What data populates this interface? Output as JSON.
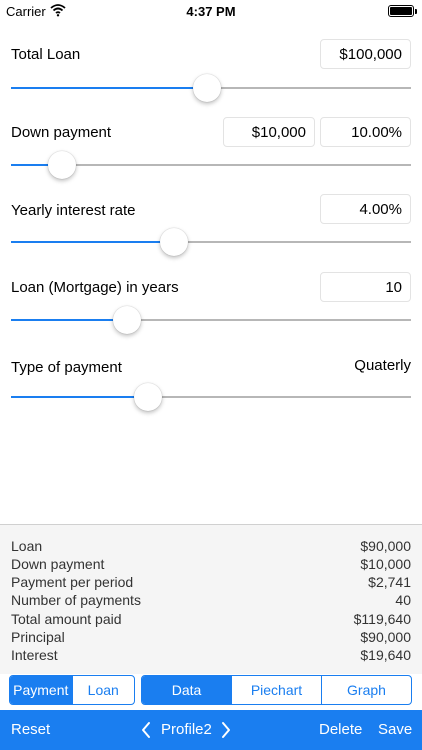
{
  "status_bar": {
    "carrier": "Carrier",
    "time": "4:37 PM"
  },
  "inputs": {
    "total_loan": {
      "label": "Total Loan",
      "value": "$100,000",
      "slider_fraction": 0.49
    },
    "down_payment": {
      "label": "Down payment",
      "amount": "$10,000",
      "percent": "10.00%",
      "slider_fraction": 0.127
    },
    "interest_rate": {
      "label": "Yearly interest rate",
      "value": "4.00%",
      "slider_fraction": 0.407
    },
    "years": {
      "label": "Loan (Mortgage) in years",
      "value": "10",
      "slider_fraction": 0.29
    },
    "payment_type": {
      "label": "Type of payment",
      "value": "Quaterly",
      "slider_fraction": 0.343
    }
  },
  "summary": [
    {
      "label": "Loan",
      "value": "$90,000"
    },
    {
      "label": "Down payment",
      "value": "$10,000"
    },
    {
      "label": "Payment per period",
      "value": "$2,741"
    },
    {
      "label": "Number of payments",
      "value": "40"
    },
    {
      "label": "Total amount paid",
      "value": "$119,640"
    },
    {
      "label": "Principal",
      "value": "$90,000"
    },
    {
      "label": "Interest",
      "value": "$19,640"
    }
  ],
  "mode_tabs": {
    "payment": "Payment",
    "loan": "Loan",
    "active": "payment"
  },
  "view_tabs": {
    "data": "Data",
    "piechart": "Piechart",
    "graph": "Graph",
    "active": "data"
  },
  "toolbar": {
    "reset": "Reset",
    "profile": "Profile2",
    "delete": "Delete",
    "save": "Save"
  },
  "colors": {
    "accent": "#1a7ef0",
    "summary_bg": "#f5f5f5"
  },
  "icons": {
    "wifi": "wifi-icon",
    "battery": "battery-icon",
    "prev": "chevron-left-icon",
    "next": "chevron-right-icon"
  }
}
